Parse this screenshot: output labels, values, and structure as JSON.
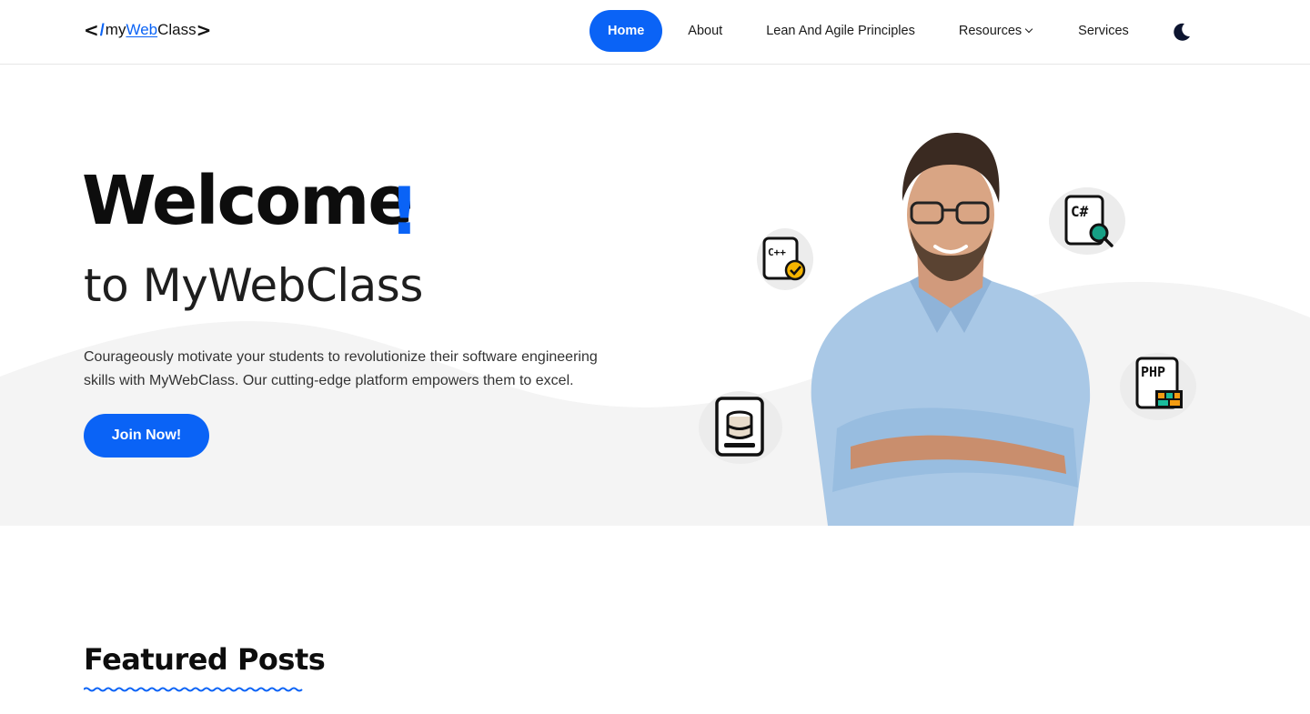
{
  "header": {
    "logo": {
      "open": "<",
      "slash": "/",
      "my": "my",
      "web": "Web",
      "class": "Class",
      "close": ">"
    },
    "nav": [
      {
        "label": "Home",
        "active": true
      },
      {
        "label": "About"
      },
      {
        "label": "Lean And Agile Principles"
      },
      {
        "label": "Resources",
        "dropdown": true
      },
      {
        "label": "Services"
      }
    ],
    "theme_toggle_icon": "moon-icon"
  },
  "hero": {
    "title": "Welcome",
    "exclamation": "!",
    "subtitle": "to MyWebClass",
    "description_line1": "Courageously motivate your students to revolutionize their software engineering",
    "description_line2": "skills with MyWebClass. Our cutting-edge platform empowers them to excel.",
    "cta_label": "Join Now!",
    "badges": [
      {
        "icon": "cpp-file-check-icon",
        "text": "C++"
      },
      {
        "icon": "csharp-file-search-icon",
        "text": "C#"
      },
      {
        "icon": "php-file-icon",
        "text": "PHP"
      },
      {
        "icon": "database-icon"
      }
    ]
  },
  "featured": {
    "title": "Featured Posts"
  },
  "colors": {
    "accent": "#0a63f6",
    "hero_bg": "#f4f4f4",
    "text": "#121212"
  }
}
